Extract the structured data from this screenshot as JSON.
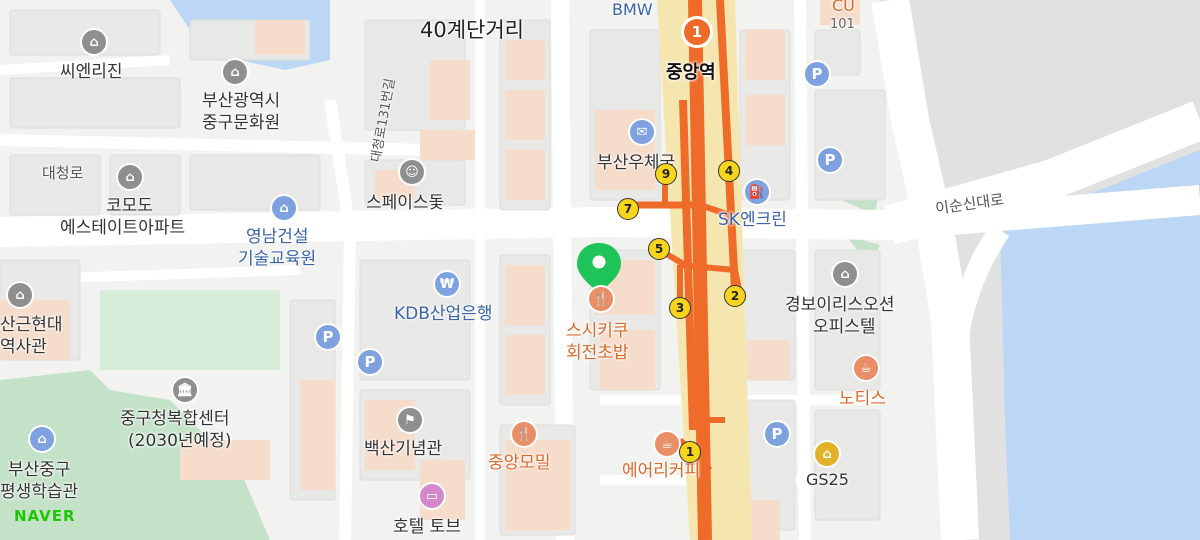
{
  "map": {
    "brand": "NAVER",
    "colors": {
      "water": "#bcd7f5",
      "park": "#c4e2c8",
      "road": "#ffffff",
      "block": "#e9e9e7",
      "building": "#f6dccb",
      "subway_line": "#ee6b2a",
      "station_band": "#f5e6b0",
      "exit_badge": "#f7d51c",
      "marker": "#1ec35a"
    },
    "labels": {
      "area_top": "40계단거리",
      "bmw": "BMW",
      "cu": "CU",
      "cu_number": "101",
      "scen": "씨엔리진",
      "cultural_center_line1": "부산광역시",
      "cultural_center_line2": "중구문화원",
      "daecheong_ro": "대청로",
      "daecheong_alley": "대청로131번길",
      "space": "스페이스돛",
      "post_office": "부산우체국",
      "sk": "SK엔크린",
      "komodo_line1": "코모도",
      "komodo_line2": "에스테이트아파트",
      "yeongnam_line1": "영남건설",
      "yeongnam_line2": "기술교육원",
      "kdb": "KDB산업은행",
      "sushi_line1": "스시키쿠",
      "sushi_line2": "회전초밥",
      "gyeongbo_line1": "경보이리스오션",
      "gyeongbo_line2": "오피스텔",
      "isunsin": "이순신대로",
      "museum_line1": "산근현대",
      "museum_line2": "역사관",
      "complex_line1": "중구청복합센터",
      "complex_line2": "(2030년예정)",
      "baeksan": "백산기념관",
      "jungang_momil": "중앙모밀",
      "noteus": "노티스",
      "air_coffee": "에어리커피",
      "gs25": "GS25",
      "lifelong_line1": "부산중구",
      "lifelong_line2": "평생학습관",
      "hotel": "호텔 토브",
      "station": "중앙역"
    },
    "subway": {
      "line_number": "1",
      "exits": [
        "1",
        "2",
        "3",
        "4",
        "5",
        "7",
        "9"
      ]
    },
    "icons": {
      "parking": "P",
      "marker": "location-pin-icon",
      "restaurant": "fork-knife-icon",
      "bank": "won-icon",
      "post": "post-office-icon",
      "building": "building-icon",
      "museum": "museum-icon",
      "cafe": "cafe-cup-icon",
      "store": "store-basket-icon",
      "hotel": "hotel-bed-icon",
      "theatre": "theatre-mask-icon",
      "gas": "gas-station-icon",
      "flag": "flag-icon"
    }
  }
}
